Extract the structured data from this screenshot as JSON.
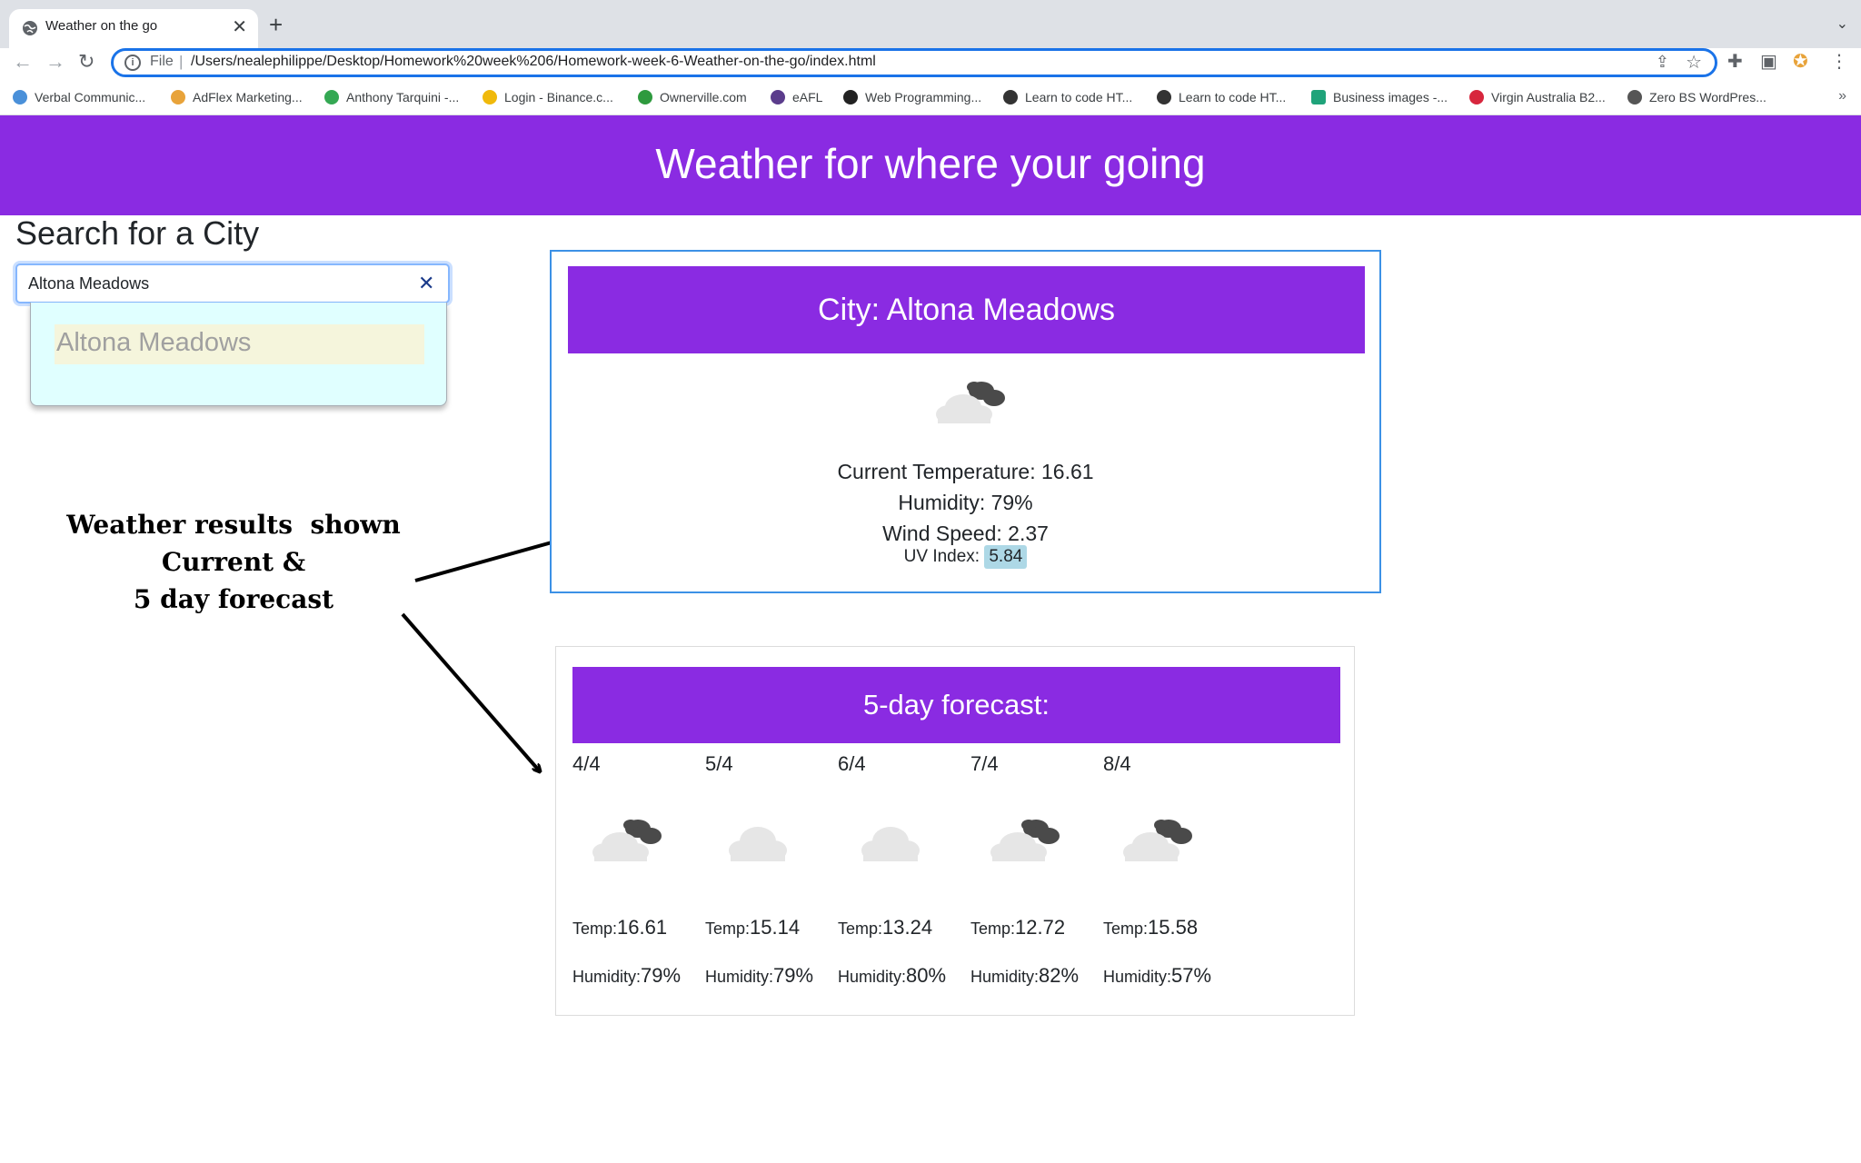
{
  "browser": {
    "tab_title": "Weather on the go",
    "tab_close": "✕",
    "new_tab": "+",
    "omnibox_scheme": "File",
    "url": "/Users/nealephilippe/Desktop/Homework%20week%206/Homework-week-6-Weather-on-the-go/index.html",
    "bookmarks": [
      {
        "label": "Verbal Communic...",
        "color": "#4a90d9"
      },
      {
        "label": "AdFlex Marketing...",
        "color": "#e8a33a"
      },
      {
        "label": "Anthony Tarquini -...",
        "color": "#34a853"
      },
      {
        "label": "Login - Binance.c...",
        "color": "#f0b90b"
      },
      {
        "label": "Ownerville.com",
        "color": "#2e9a3e"
      },
      {
        "label": "eAFL",
        "color": "#5b3c8c"
      },
      {
        "label": "Web Programming...",
        "color": "#222222"
      },
      {
        "label": "Learn to code HT...",
        "color": "#333333"
      },
      {
        "label": "Learn to code HT...",
        "color": "#333333"
      },
      {
        "label": "Business images -...",
        "color": "#1fa37a"
      },
      {
        "label": "Virgin Australia B2...",
        "color": "#d7263d"
      },
      {
        "label": "Zero BS WordPres...",
        "color": "#555555"
      }
    ],
    "bookmarks_more": "»"
  },
  "page": {
    "header_title": "Weather for where your going",
    "search_heading": "Search for a City",
    "search_value": "Altona Meadows",
    "search_clear": "✕",
    "suggestion": "Altona Meadows",
    "annotation": [
      "Weather results  shown",
      "Current &",
      "5 day forecast"
    ]
  },
  "current": {
    "city_title": "City: Altona Meadows",
    "icon": "broken-clouds-icon",
    "temperature": "Current Temperature: 16.61",
    "humidity": "Humidity: 79%",
    "wind": "Wind Speed: 2.37",
    "uv_label": "UV Index:",
    "uv_value": "5.84"
  },
  "forecast": {
    "title": "5-day forecast:",
    "temp_label": "Temp:",
    "humidity_label": "Humidity:",
    "days": [
      {
        "date": "4/4",
        "icon": "broken-clouds-icon",
        "temp": "16.61",
        "humidity": "79%"
      },
      {
        "date": "5/4",
        "icon": "overcast-clouds-icon",
        "temp": "15.14",
        "humidity": "79%"
      },
      {
        "date": "6/4",
        "icon": "overcast-clouds-icon",
        "temp": "13.24",
        "humidity": "80%"
      },
      {
        "date": "7/4",
        "icon": "broken-clouds-icon",
        "temp": "12.72",
        "humidity": "82%"
      },
      {
        "date": "8/4",
        "icon": "broken-clouds-icon",
        "temp": "15.58",
        "humidity": "57%"
      }
    ]
  },
  "colors": {
    "header_bg": "#8a2be2",
    "uv_badge": "#add8e6",
    "suggest_bg": "#e0ffff",
    "suggest_item_bg": "#f5f5dc",
    "focus_border": "#1a73e8"
  }
}
